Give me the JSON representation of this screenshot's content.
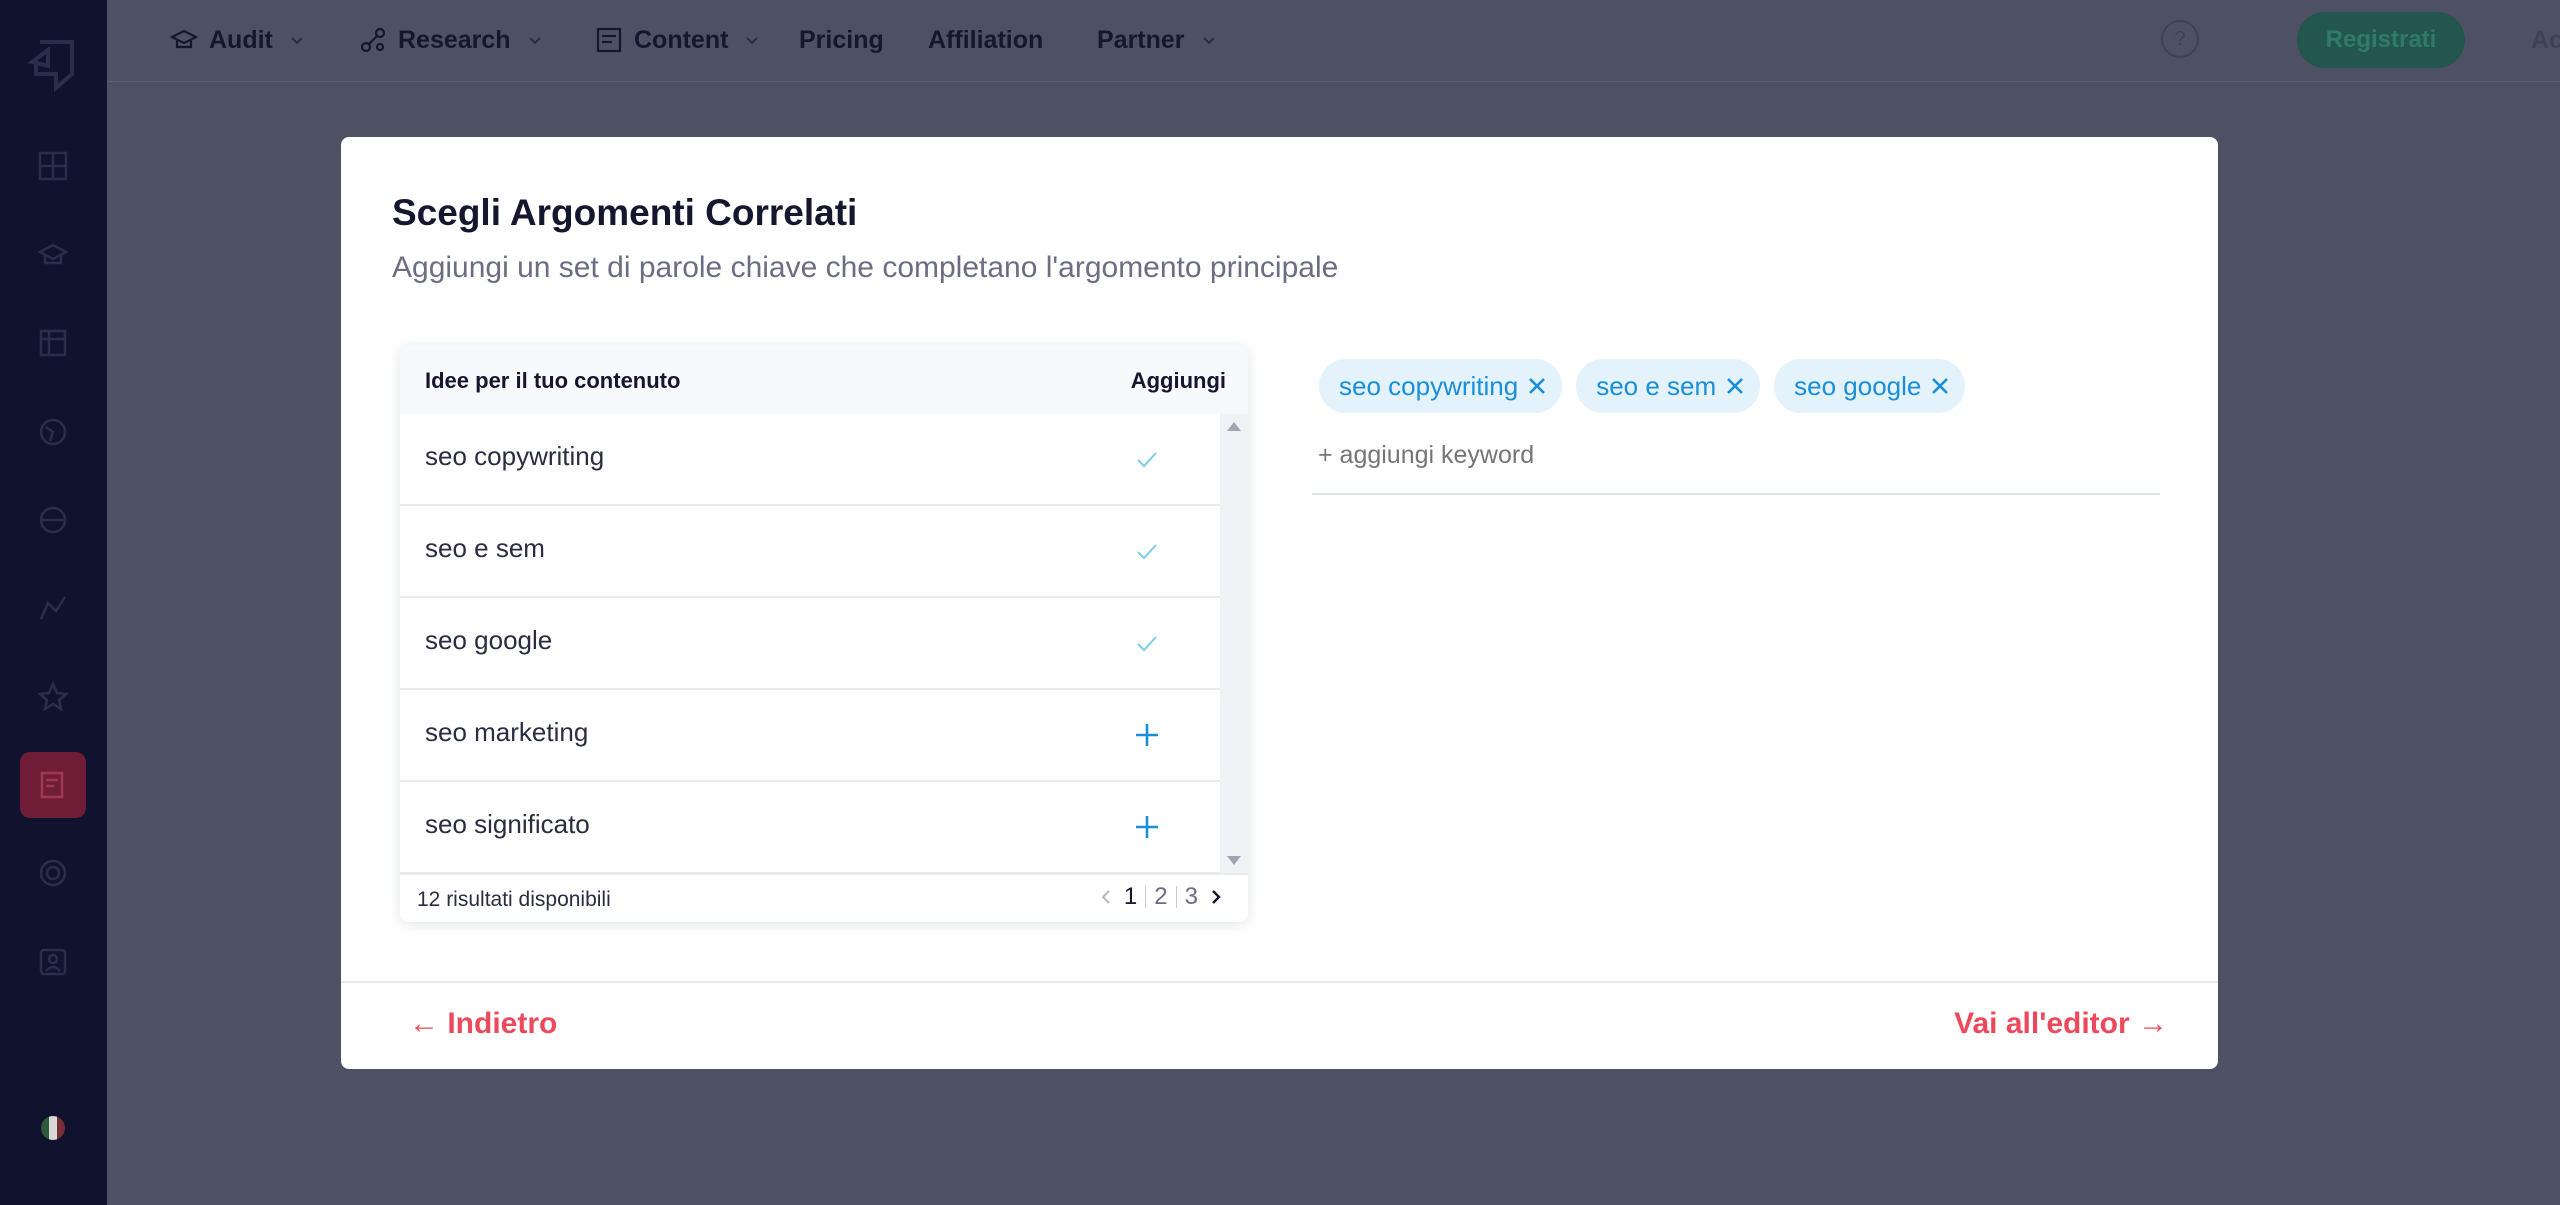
{
  "nav": {
    "items": [
      {
        "label": "Audit",
        "icon": "graduation-cap-icon",
        "dropdown": true
      },
      {
        "label": "Research",
        "icon": "network-icon",
        "dropdown": true
      },
      {
        "label": "Content",
        "icon": "document-edit-icon",
        "dropdown": true
      },
      {
        "label": "Pricing",
        "dropdown": false
      },
      {
        "label": "Affiliation",
        "dropdown": false
      },
      {
        "label": "Partner",
        "dropdown": true
      }
    ],
    "help_icon": "?",
    "register_label": "Registrati",
    "login_label": "Accedi"
  },
  "sidebar": {
    "items": [
      {
        "icon": "dashboard-icon"
      },
      {
        "icon": "audit-icon"
      },
      {
        "icon": "table-icon"
      },
      {
        "icon": "globe-icon"
      },
      {
        "icon": "analysis-icon"
      },
      {
        "icon": "graph-icon"
      },
      {
        "icon": "star-icon"
      },
      {
        "icon": "content-editor-icon",
        "active": true
      },
      {
        "icon": "target-icon"
      },
      {
        "icon": "user-card-icon"
      }
    ],
    "language": "it"
  },
  "modal": {
    "title": "Scegli Argomenti Correlati",
    "subtitle": "Aggiungi un set di parole chiave che completano l'argomento principale",
    "ideas": {
      "header_left": "Idee per il tuo contenuto",
      "header_right": "Aggiungi",
      "rows": [
        {
          "keyword": "seo copywriting",
          "added": true
        },
        {
          "keyword": "seo e sem",
          "added": true
        },
        {
          "keyword": "seo google",
          "added": true
        },
        {
          "keyword": "seo marketing",
          "added": false
        },
        {
          "keyword": "seo significato",
          "added": false
        }
      ],
      "results_text": "12 risultati disponibili",
      "pages": [
        "1",
        "2",
        "3"
      ],
      "current_page": "1"
    },
    "selected_keywords": [
      "seo copywriting",
      "seo e sem",
      "seo google"
    ],
    "add_keyword_placeholder": "+ aggiungi keyword",
    "back_label": "← Indietro",
    "next_label": "Vai all'editor →"
  },
  "colors": {
    "accent_red": "#ec4a5c",
    "accent_blue": "#1a8fd8",
    "sidebar_bg": "#10122e",
    "overlay_bg": "#4e5163"
  }
}
